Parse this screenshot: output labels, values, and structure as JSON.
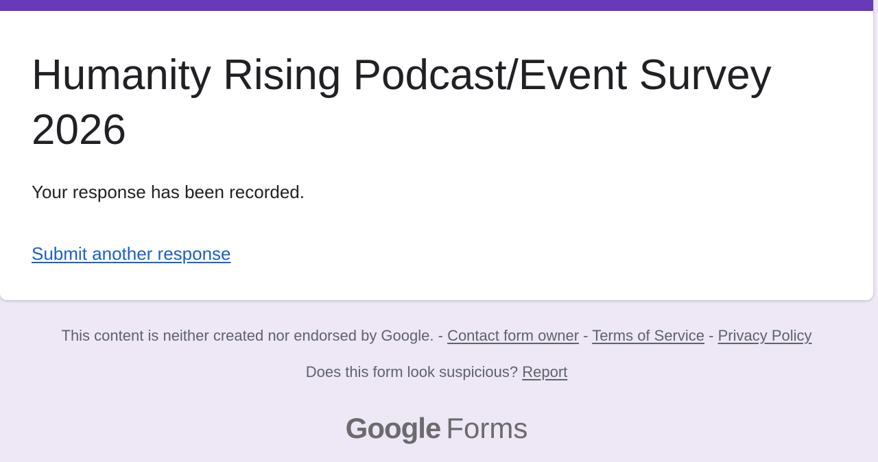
{
  "form": {
    "title": "Humanity Rising Podcast/Event Survey 2026",
    "confirmation": "Your response has been recorded.",
    "submit_another": "Submit another response"
  },
  "footer": {
    "disclaimer": "This content is neither created nor endorsed by Google.",
    "separator": " - ",
    "contact_link": "Contact form owner",
    "terms_link": "Terms of Service",
    "privacy_link": "Privacy Policy",
    "suspicious_text": "Does this form look suspicious?",
    "report_link": "Report"
  },
  "brand": {
    "google": "Google",
    "forms": "Forms"
  },
  "colors": {
    "accent": "#673ab7",
    "background": "#ede7f6",
    "link": "#1a61c8",
    "text": "#202124",
    "muted": "#5f6368"
  }
}
